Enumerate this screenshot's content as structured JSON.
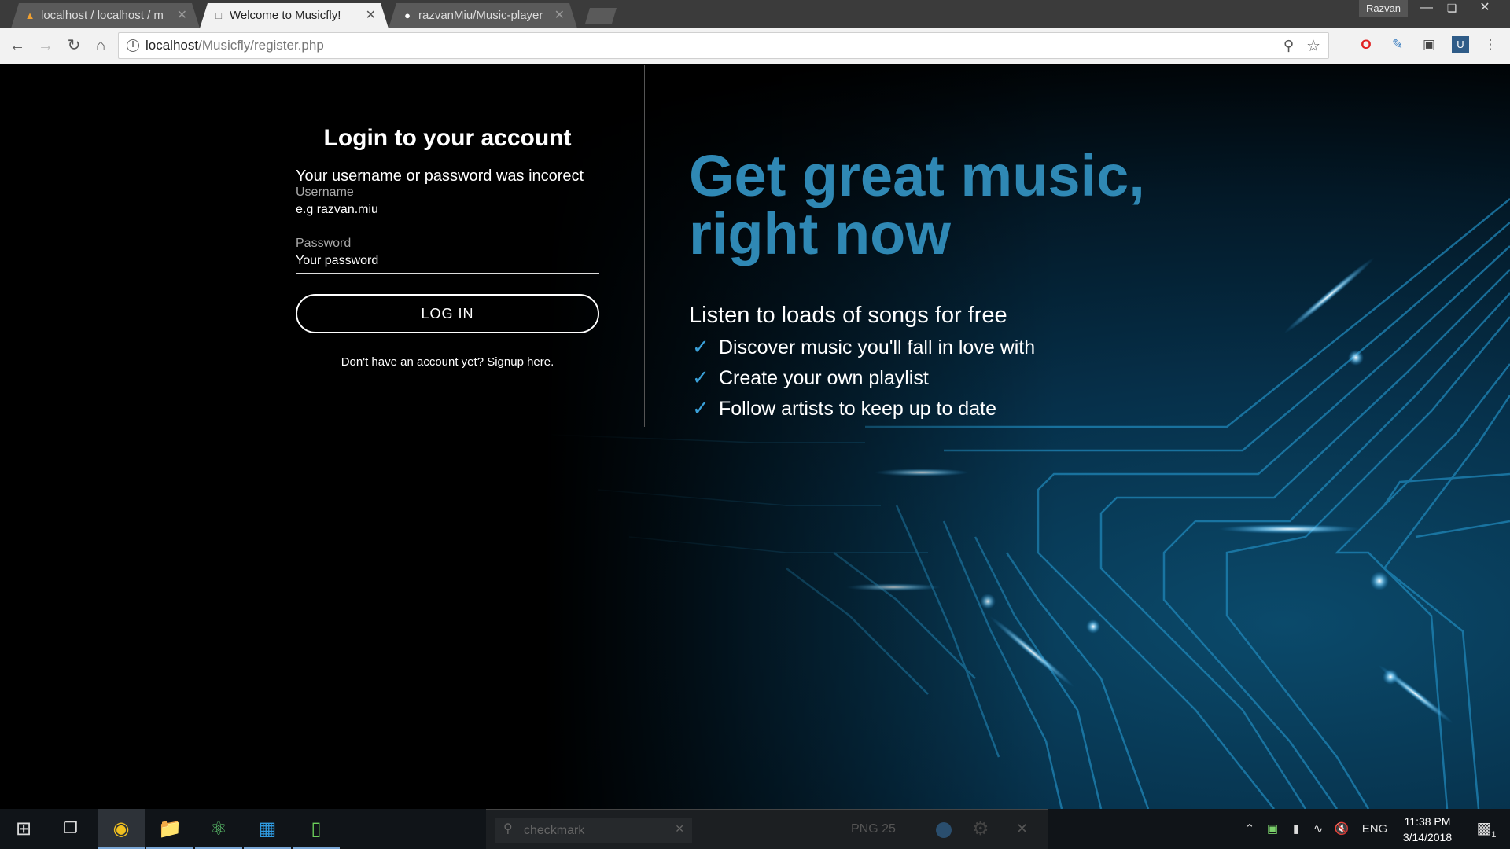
{
  "browser": {
    "tabs": [
      {
        "label": "localhost / localhost / m",
        "icon": "phpmyadmin-icon",
        "active": false
      },
      {
        "label": "Welcome to Musicfly!",
        "icon": "page-icon",
        "active": true
      },
      {
        "label": "razvanMiu/Music-player",
        "icon": "github-icon",
        "active": false
      }
    ],
    "profile_name": "Razvan",
    "url_host": "localhost",
    "url_path": "/Musicfly/register.php"
  },
  "login": {
    "title": "Login to your account",
    "error": "Your username or password was incorect",
    "username_label": "Username",
    "username_placeholder": "e.g razvan.miu",
    "password_label": "Password",
    "password_placeholder": "Your password",
    "login_button": "LOG IN",
    "signup_text": "Don't have an account yet? Signup here."
  },
  "hero": {
    "title": "Get great music, right now",
    "subtitle": "Listen to loads of songs for free",
    "features": [
      "Discover music you'll fall in love with",
      "Create your own playlist",
      "Follow artists to keep up to date"
    ],
    "accent_color": "#2f88b4"
  },
  "taskbar": {
    "search_text": "checkmark",
    "format": "PNG 25",
    "language": "ENG",
    "time": "11:38 PM",
    "date": "3/14/2018",
    "notification_count": "1"
  }
}
